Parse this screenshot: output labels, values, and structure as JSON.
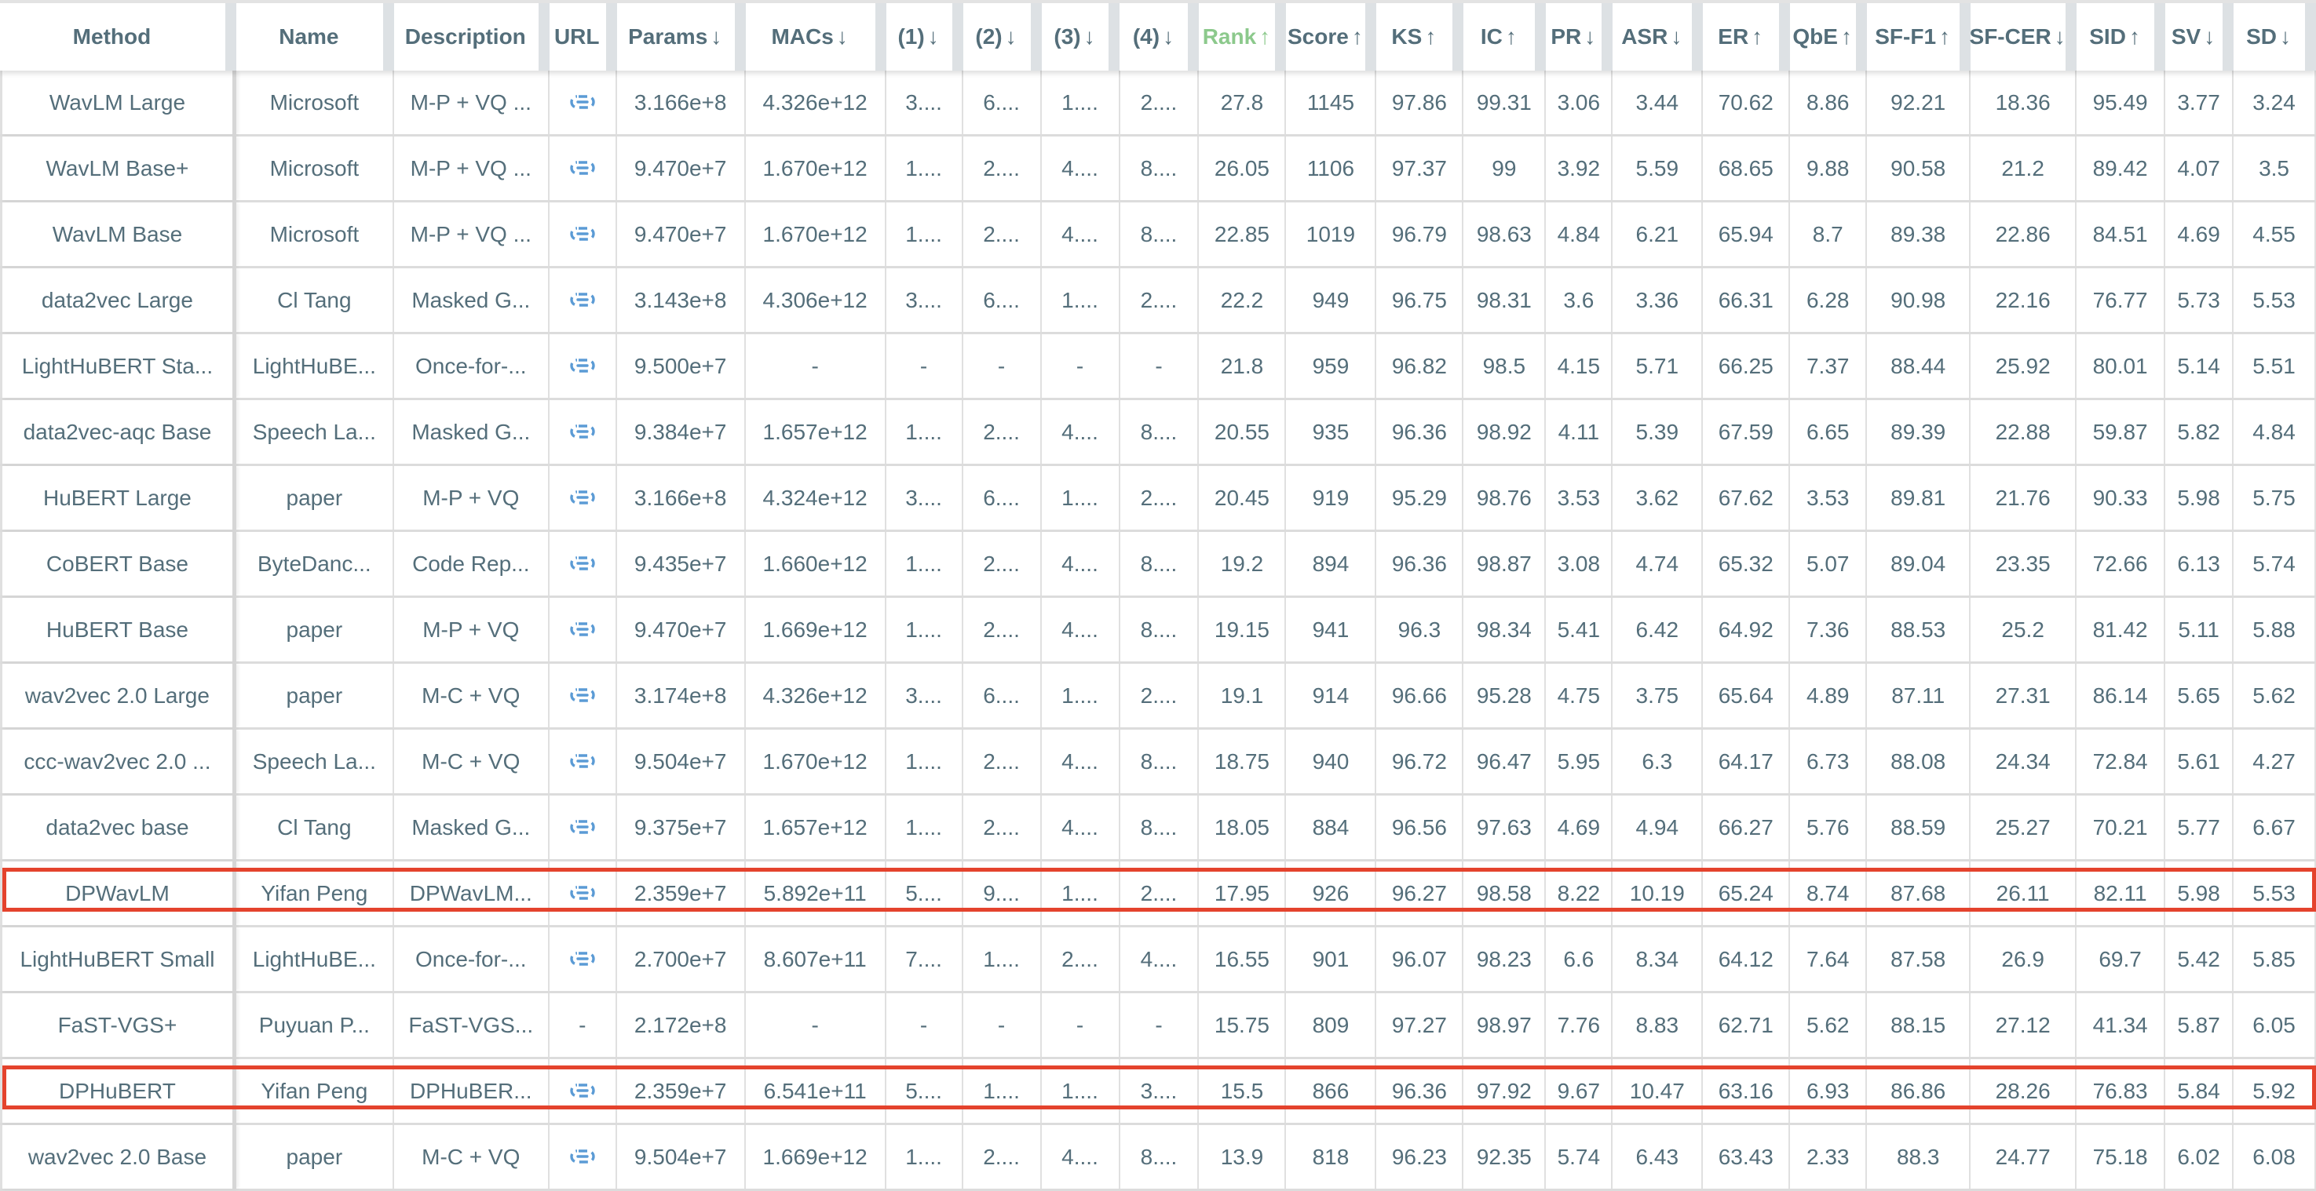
{
  "table": {
    "columns": [
      {
        "label": "Method",
        "arrow": ""
      },
      {
        "label": "Name",
        "arrow": ""
      },
      {
        "label": "Description",
        "arrow": ""
      },
      {
        "label": "URL",
        "arrow": ""
      },
      {
        "label": "Params",
        "arrow": "↓"
      },
      {
        "label": "MACs",
        "arrow": "↓"
      },
      {
        "label": "(1)",
        "arrow": "↓"
      },
      {
        "label": "(2)",
        "arrow": "↓"
      },
      {
        "label": "(3)",
        "arrow": "↓"
      },
      {
        "label": "(4)",
        "arrow": "↓"
      },
      {
        "label": "Rank",
        "arrow": "↑",
        "active": true
      },
      {
        "label": "Score",
        "arrow": "↑"
      },
      {
        "label": "KS",
        "arrow": "↑"
      },
      {
        "label": "IC",
        "arrow": "↑"
      },
      {
        "label": "PR",
        "arrow": "↓"
      },
      {
        "label": "ASR",
        "arrow": "↓"
      },
      {
        "label": "ER",
        "arrow": "↑"
      },
      {
        "label": "QbE",
        "arrow": "↑"
      },
      {
        "label": "SF-F1",
        "arrow": "↑"
      },
      {
        "label": "SF-CER",
        "arrow": "↓"
      },
      {
        "label": "SID",
        "arrow": "↑"
      },
      {
        "label": "SV",
        "arrow": "↓"
      },
      {
        "label": "SD",
        "arrow": "↓"
      }
    ],
    "rows": [
      {
        "cells": [
          "WavLM Large",
          "Microsoft",
          "M-P + VQ ...",
          "link",
          "3.166e+8",
          "4.326e+12",
          "3....",
          "6....",
          "1....",
          "2....",
          "27.8",
          "1145",
          "97.86",
          "99.31",
          "3.06",
          "3.44",
          "70.62",
          "8.86",
          "92.21",
          "18.36",
          "95.49",
          "3.77",
          "3.24"
        ]
      },
      {
        "cells": [
          "WavLM Base+",
          "Microsoft",
          "M-P + VQ ...",
          "link",
          "9.470e+7",
          "1.670e+12",
          "1....",
          "2....",
          "4....",
          "8....",
          "26.05",
          "1106",
          "97.37",
          "99",
          "3.92",
          "5.59",
          "68.65",
          "9.88",
          "90.58",
          "21.2",
          "89.42",
          "4.07",
          "3.5"
        ]
      },
      {
        "cells": [
          "WavLM Base",
          "Microsoft",
          "M-P + VQ ...",
          "link",
          "9.470e+7",
          "1.670e+12",
          "1....",
          "2....",
          "4....",
          "8....",
          "22.85",
          "1019",
          "96.79",
          "98.63",
          "4.84",
          "6.21",
          "65.94",
          "8.7",
          "89.38",
          "22.86",
          "84.51",
          "4.69",
          "4.55"
        ]
      },
      {
        "cells": [
          "data2vec Large",
          "Cl Tang",
          "Masked G...",
          "link",
          "3.143e+8",
          "4.306e+12",
          "3....",
          "6....",
          "1....",
          "2....",
          "22.2",
          "949",
          "96.75",
          "98.31",
          "3.6",
          "3.36",
          "66.31",
          "6.28",
          "90.98",
          "22.16",
          "76.77",
          "5.73",
          "5.53"
        ]
      },
      {
        "cells": [
          "LightHuBERT Sta...",
          "LightHuBE...",
          "Once-for-...",
          "link",
          "9.500e+7",
          "-",
          "-",
          "-",
          "-",
          "-",
          "21.8",
          "959",
          "96.82",
          "98.5",
          "4.15",
          "5.71",
          "66.25",
          "7.37",
          "88.44",
          "25.92",
          "80.01",
          "5.14",
          "5.51"
        ]
      },
      {
        "cells": [
          "data2vec-aqc Base",
          "Speech La...",
          "Masked G...",
          "link",
          "9.384e+7",
          "1.657e+12",
          "1....",
          "2....",
          "4....",
          "8....",
          "20.55",
          "935",
          "96.36",
          "98.92",
          "4.11",
          "5.39",
          "67.59",
          "6.65",
          "89.39",
          "22.88",
          "59.87",
          "5.82",
          "4.84"
        ]
      },
      {
        "cells": [
          "HuBERT Large",
          "paper",
          "M-P + VQ",
          "link",
          "3.166e+8",
          "4.324e+12",
          "3....",
          "6....",
          "1....",
          "2....",
          "20.45",
          "919",
          "95.29",
          "98.76",
          "3.53",
          "3.62",
          "67.62",
          "3.53",
          "89.81",
          "21.76",
          "90.33",
          "5.98",
          "5.75"
        ]
      },
      {
        "cells": [
          "CoBERT Base",
          "ByteDanc...",
          "Code Rep...",
          "link",
          "9.435e+7",
          "1.660e+12",
          "1....",
          "2....",
          "4....",
          "8....",
          "19.2",
          "894",
          "96.36",
          "98.87",
          "3.08",
          "4.74",
          "65.32",
          "5.07",
          "89.04",
          "23.35",
          "72.66",
          "6.13",
          "5.74"
        ]
      },
      {
        "cells": [
          "HuBERT Base",
          "paper",
          "M-P + VQ",
          "link",
          "9.470e+7",
          "1.669e+12",
          "1....",
          "2....",
          "4....",
          "8....",
          "19.15",
          "941",
          "96.3",
          "98.34",
          "5.41",
          "6.42",
          "64.92",
          "7.36",
          "88.53",
          "25.2",
          "81.42",
          "5.11",
          "5.88"
        ]
      },
      {
        "cells": [
          "wav2vec 2.0 Large",
          "paper",
          "M-C + VQ",
          "link",
          "3.174e+8",
          "4.326e+12",
          "3....",
          "6....",
          "1....",
          "2....",
          "19.1",
          "914",
          "96.66",
          "95.28",
          "4.75",
          "3.75",
          "65.64",
          "4.89",
          "87.11",
          "27.31",
          "86.14",
          "5.65",
          "5.62"
        ]
      },
      {
        "cells": [
          "ccc-wav2vec 2.0 ...",
          "Speech La...",
          "M-C + VQ",
          "link",
          "9.504e+7",
          "1.670e+12",
          "1....",
          "2....",
          "4....",
          "8....",
          "18.75",
          "940",
          "96.72",
          "96.47",
          "5.95",
          "6.3",
          "64.17",
          "6.73",
          "88.08",
          "24.34",
          "72.84",
          "5.61",
          "4.27"
        ]
      },
      {
        "cells": [
          "data2vec base",
          "Cl Tang",
          "Masked G...",
          "link",
          "9.375e+7",
          "1.657e+12",
          "1....",
          "2....",
          "4....",
          "8....",
          "18.05",
          "884",
          "96.56",
          "97.63",
          "4.69",
          "4.94",
          "66.27",
          "5.76",
          "88.59",
          "25.27",
          "70.21",
          "5.77",
          "6.67"
        ]
      },
      {
        "cells": [
          "DPWavLM",
          "Yifan Peng",
          "DPWavLM...",
          "link",
          "2.359e+7",
          "5.892e+11",
          "5....",
          "9....",
          "1....",
          "2....",
          "17.95",
          "926",
          "96.27",
          "98.58",
          "8.22",
          "10.19",
          "65.24",
          "8.74",
          "87.68",
          "26.11",
          "82.11",
          "5.98",
          "5.53"
        ],
        "highlighted": true
      },
      {
        "cells": [
          "LightHuBERT Small",
          "LightHuBE...",
          "Once-for-...",
          "link",
          "2.700e+7",
          "8.607e+11",
          "7....",
          "1....",
          "2....",
          "4....",
          "16.55",
          "901",
          "96.07",
          "98.23",
          "6.6",
          "8.34",
          "64.12",
          "7.64",
          "87.58",
          "26.9",
          "69.7",
          "5.42",
          "5.85"
        ]
      },
      {
        "cells": [
          "FaST-VGS+",
          "Puyuan P...",
          "FaST-VGS...",
          "-",
          "2.172e+8",
          "-",
          "-",
          "-",
          "-",
          "-",
          "15.75",
          "809",
          "97.27",
          "98.97",
          "7.76",
          "8.83",
          "62.71",
          "5.62",
          "88.15",
          "27.12",
          "41.34",
          "5.87",
          "6.05"
        ]
      },
      {
        "cells": [
          "DPHuBERT",
          "Yifan Peng",
          "DPHuBER...",
          "link",
          "2.359e+7",
          "6.541e+11",
          "5....",
          "1....",
          "1....",
          "3....",
          "15.5",
          "866",
          "96.36",
          "97.92",
          "9.67",
          "10.47",
          "63.16",
          "6.93",
          "86.86",
          "28.26",
          "76.83",
          "5.84",
          "5.92"
        ],
        "highlighted": true
      },
      {
        "cells": [
          "wav2vec 2.0 Base",
          "paper",
          "M-C + VQ",
          "link",
          "9.504e+7",
          "1.669e+12",
          "1....",
          "2....",
          "4....",
          "8....",
          "13.9",
          "818",
          "96.23",
          "92.35",
          "5.74",
          "6.43",
          "63.43",
          "2.33",
          "88.3",
          "24.77",
          "75.18",
          "6.02",
          "6.08"
        ]
      }
    ]
  },
  "colors": {
    "text": "#546e7a",
    "active_sort": "#8cc98c",
    "link_icon": "#5b9bd5",
    "highlight_box": "#e4432d"
  }
}
